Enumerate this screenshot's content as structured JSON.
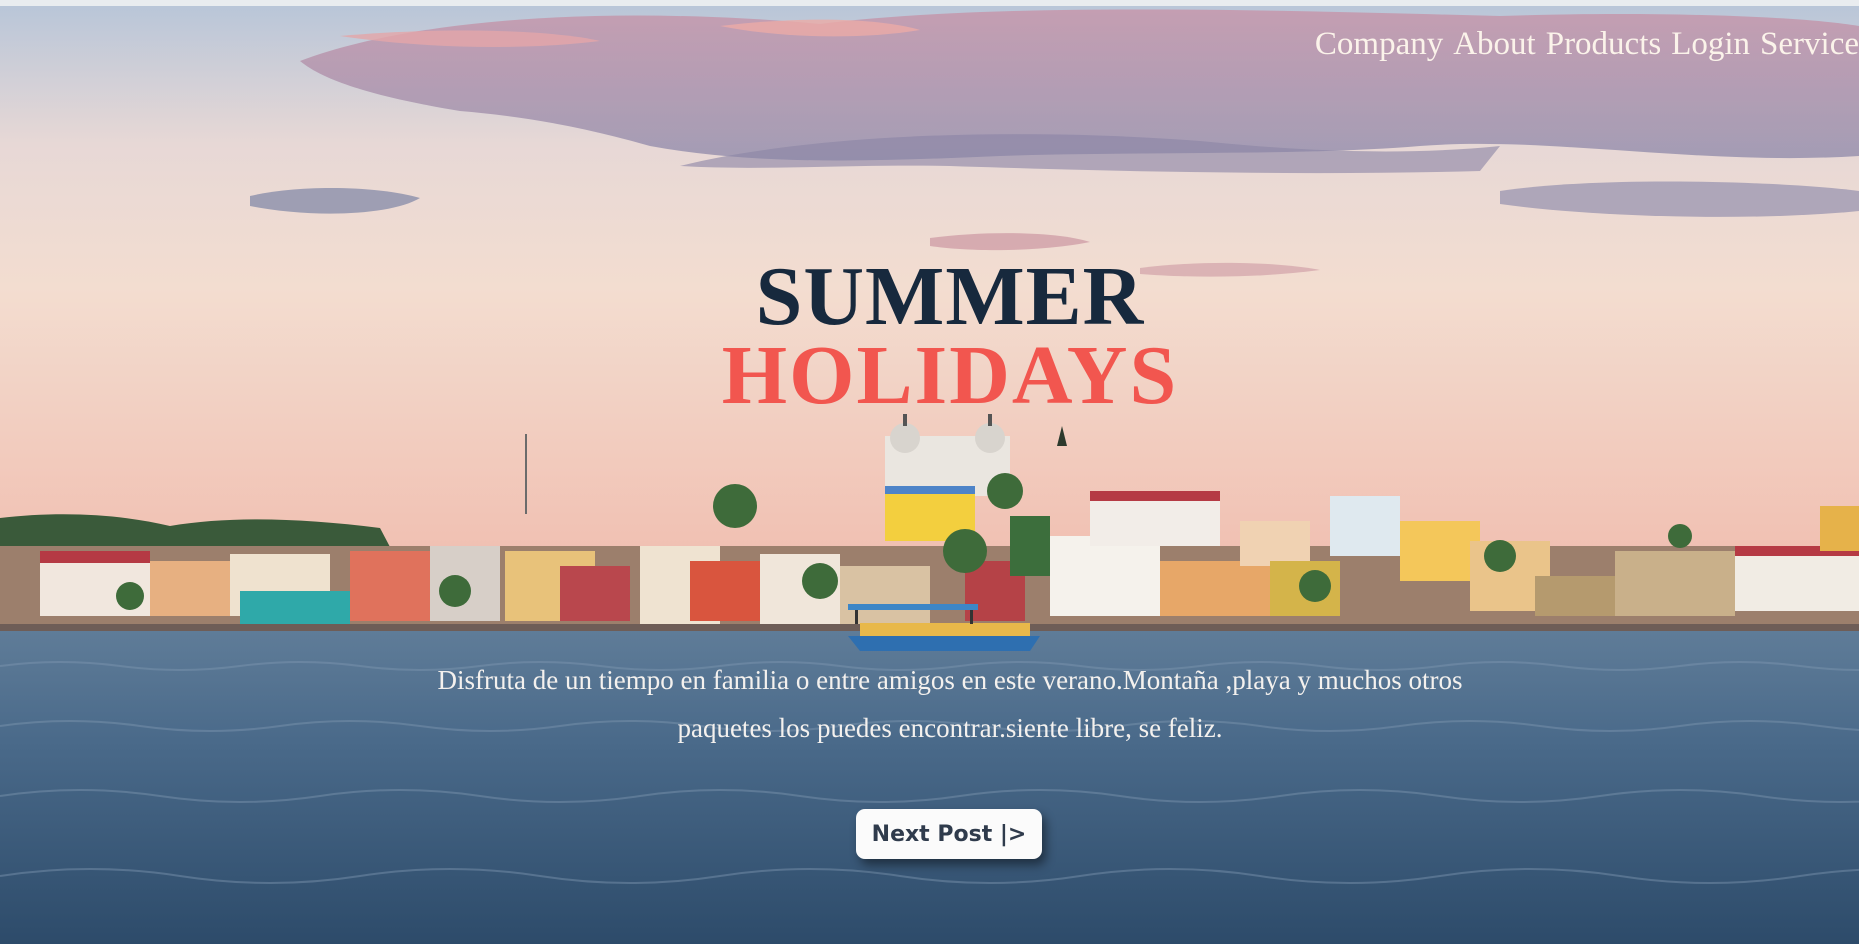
{
  "nav": {
    "items": [
      {
        "label": "Company"
      },
      {
        "label": "About"
      },
      {
        "label": "Products"
      },
      {
        "label": "Login"
      },
      {
        "label": "Service"
      }
    ]
  },
  "hero": {
    "title_line1": "SUMMER",
    "title_line2": "HOLIDAYS",
    "description": "Disfruta de un tiempo en familia o entre amigos en este verano.Montaña ,playa y muchos otros paquetes los puedes encontrar.siente libre, se feliz.",
    "button_label": "Next Post  |>"
  },
  "colors": {
    "title_dark": "#17293d",
    "title_accent": "#f2564f",
    "nav_text": "#fbf3ea",
    "button_bg": "#fbfbfb",
    "button_text": "#2f3b4c"
  }
}
